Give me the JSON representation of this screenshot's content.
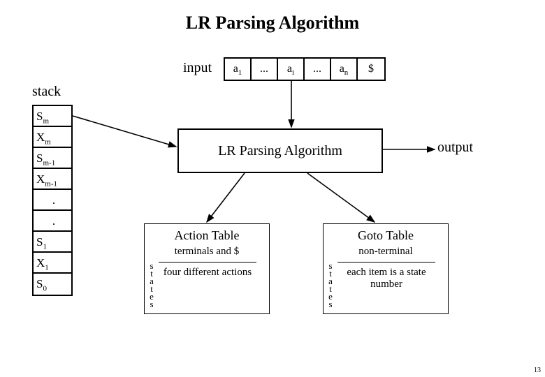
{
  "title": "LR Parsing Algorithm",
  "input_label": "input",
  "input_cells": [
    "a<sub>1</sub>",
    "...",
    "a<sub>i</sub>",
    "...",
    "a<sub>n</sub>",
    "$"
  ],
  "stack_label": "stack",
  "stack_cells": [
    "S<sub>m</sub>",
    "X<sub>m</sub>",
    "S<sub>m-1</sub>",
    "X<sub>m-1</sub>",
    ".",
    ".",
    "S<sub>1</sub>",
    "X<sub>1</sub>",
    "S<sub>0</sub>"
  ],
  "algo_box": "LR Parsing Algorithm",
  "output_label": "output",
  "action_table": {
    "title": "Action Table",
    "subtitle": "terminals and $",
    "rowlabel": "states",
    "desc": "four different\nactions"
  },
  "goto_table": {
    "title": "Goto Table",
    "subtitle": "non-terminal",
    "rowlabel": "states",
    "desc": "each item is\na state number"
  },
  "page_number": "13"
}
